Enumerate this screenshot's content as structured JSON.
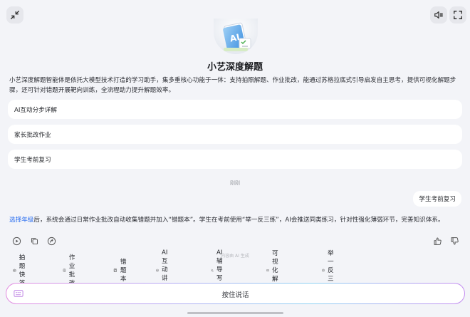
{
  "agent": {
    "title": "小艺深度解题",
    "description": "小艺深度解题智能体是依托大模型技术打造的学习助手，集多重核心功能于一体：支持拍照解题、作业批改，能通过苏格拉底式引导启发自主思考，提供可视化解题步骤，还可针对错题开展靶向训练，全流程助力提升解题效率。",
    "suggestions": [
      {
        "label": "AI互动分步详解"
      },
      {
        "label": "家长批改作业"
      },
      {
        "label": "学生考前复习"
      }
    ]
  },
  "conversation": {
    "timestamp": "刚刚",
    "user_message": "学生考前复习",
    "answer_link": "选择年级",
    "answer_text": "后，系统会通过日常作业批改自动收集错题并加入“错题本”。学生在考前使用“举一反三练”，AI会推送同类练习，针对性强化薄弱环节，完善知识体系。"
  },
  "disclaimer": "内容由 AI 生成",
  "chips": [
    {
      "label": "拍题快答",
      "icon": "camera-icon"
    },
    {
      "label": "作业批改",
      "icon": "homework-icon"
    },
    {
      "label": "错题本",
      "icon": "notebook-icon"
    },
    {
      "label": "AI互动讲解",
      "icon": "ai-tutor-icon"
    },
    {
      "label": "AI辅导写作",
      "icon": "writing-icon"
    },
    {
      "label": "可视化解题",
      "icon": "video-icon"
    },
    {
      "label": "举一反三练",
      "icon": "practice-icon"
    }
  ],
  "input": {
    "hold_to_talk_label": "按住说话"
  },
  "colors": {
    "background": "#f3f4f8",
    "link": "#2a6ef0",
    "card": "#ffffff"
  }
}
